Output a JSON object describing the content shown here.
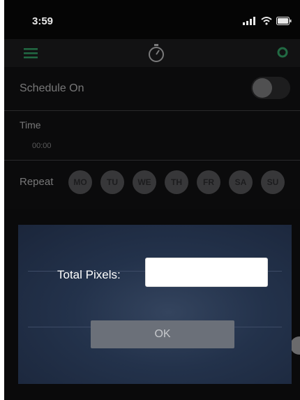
{
  "status_bar": {
    "time": "3:59",
    "icons": [
      "signal-icon",
      "wifi-icon",
      "battery-icon"
    ]
  },
  "nav": {
    "icons": [
      "menu-icon",
      "stopwatch-icon",
      "gear-icon"
    ],
    "accent": "#2fb36b"
  },
  "schedule": {
    "label": "Schedule On",
    "enabled": false
  },
  "time": {
    "label": "Time",
    "value": "00:00"
  },
  "repeat": {
    "label": "Repeat",
    "days": [
      "MO",
      "TU",
      "WE",
      "TH",
      "FR",
      "SA",
      "SU"
    ]
  },
  "dialog": {
    "label": "Total Pixels:",
    "input_value": "",
    "ok_label": "OK"
  }
}
